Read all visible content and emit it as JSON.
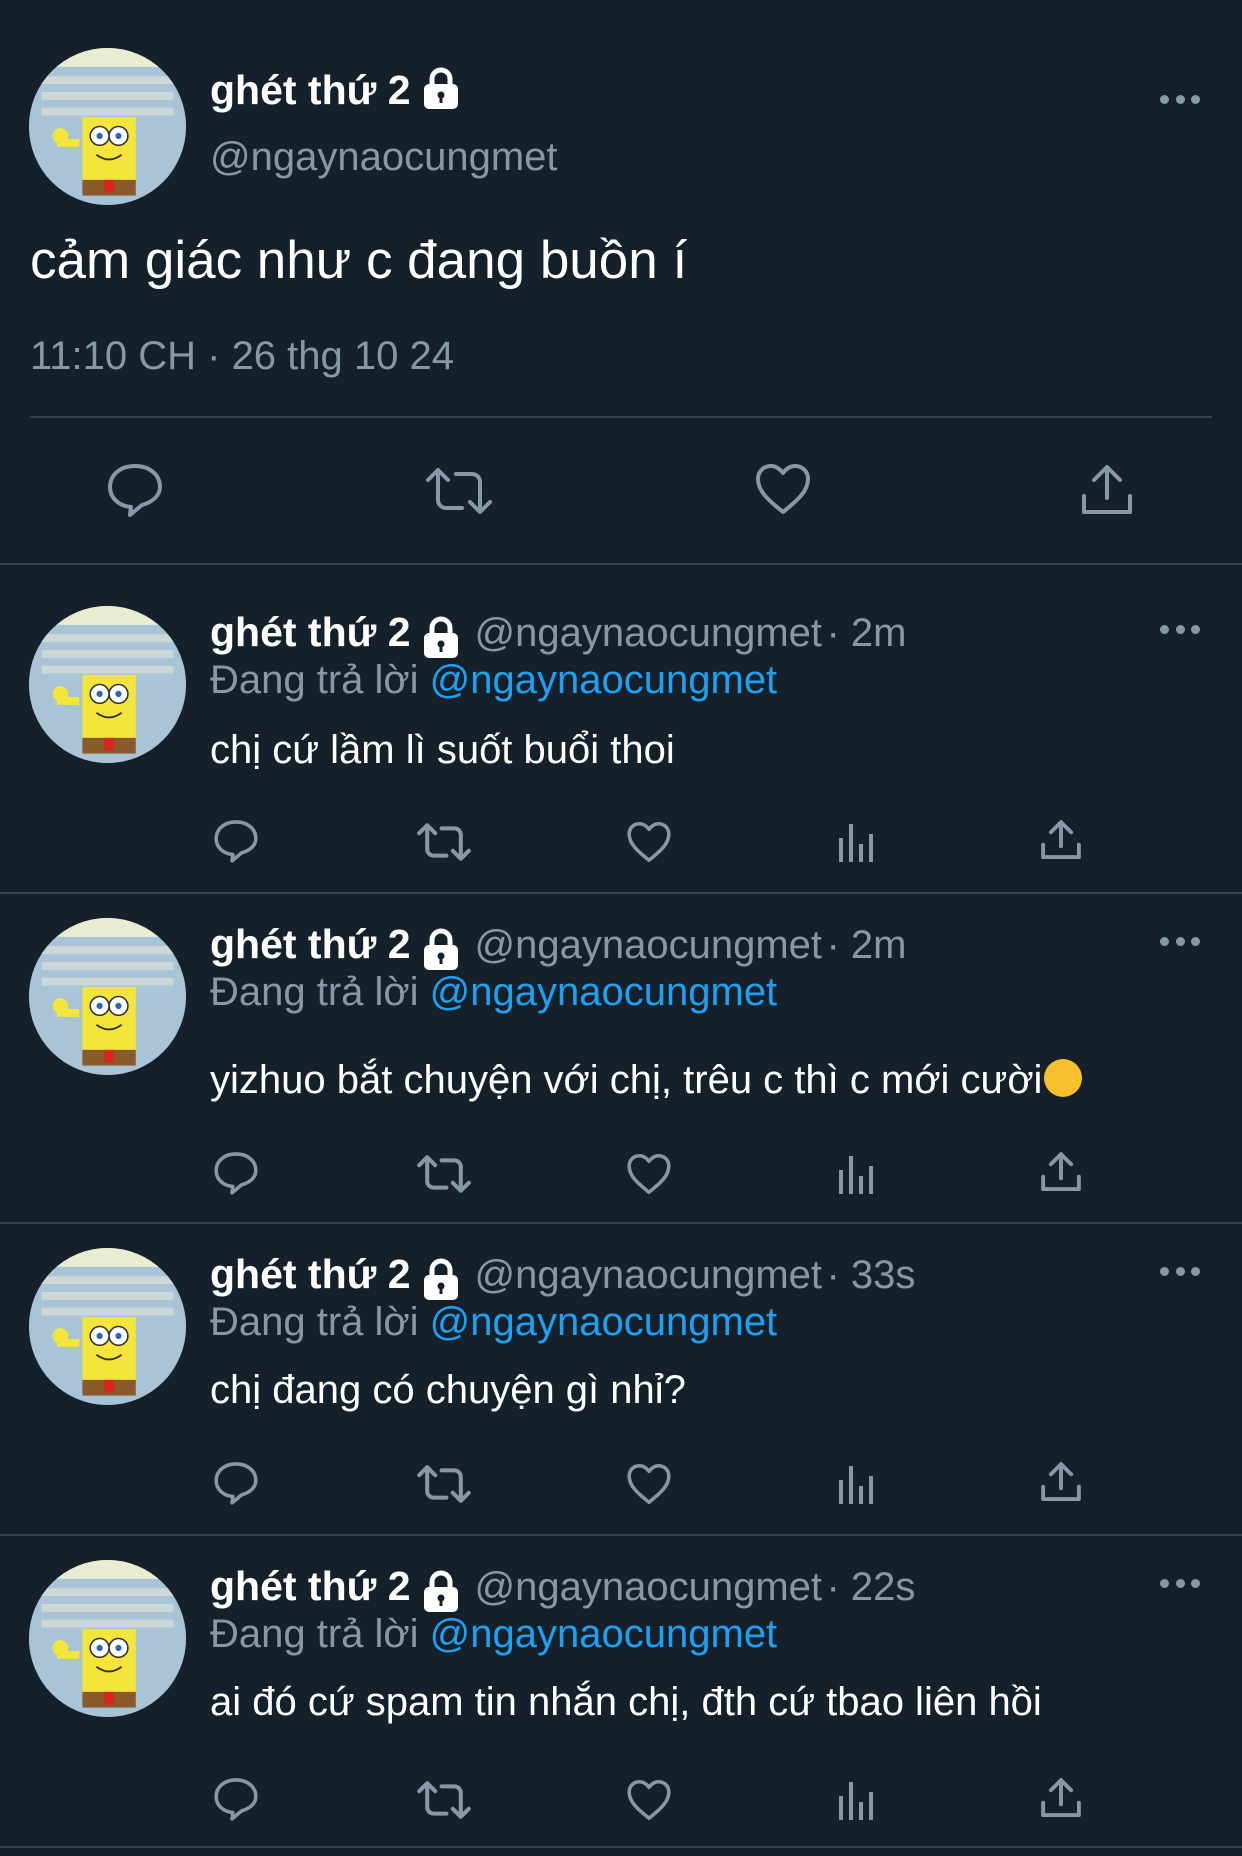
{
  "main": {
    "name": "ghét thứ 2",
    "handle": "@ngaynaocungmet",
    "text": "cảm giác như c đang buồn í",
    "timestamp": "11:10 CH · 26 thg 10 24",
    "actions": [
      "reply-icon",
      "retweet-icon",
      "like-icon",
      "share-icon"
    ]
  },
  "replies": [
    {
      "name": "ghét thứ 2",
      "handle": "@ngaynaocungmet",
      "time": "· 2m",
      "replying_prefix": "Đang trả lời",
      "replying_to": "@ngaynaocungmet",
      "text": "chị cứ lầm lì suốt buổi thoi"
    },
    {
      "name": "ghét thứ 2",
      "handle": "@ngaynaocungmet",
      "time": "· 2m",
      "replying_prefix": "Đang trả lời",
      "replying_to": "@ngaynaocungmet",
      "text": "yizhuo bắt chuyện với chị, trêu c thì c mới cười"
    },
    {
      "name": "ghét thứ 2",
      "handle": "@ngaynaocungmet",
      "time": "· 33s",
      "replying_prefix": "Đang trả lời",
      "replying_to": "@ngaynaocungmet",
      "text": "chị đang có chuyện gì nhỉ?"
    },
    {
      "name": "ghét thứ 2",
      "handle": "@ngaynaocungmet",
      "time": "· 22s",
      "replying_prefix": "Đang trả lời",
      "replying_to": "@ngaynaocungmet",
      "text": "ai đó cứ spam tin nhắn chị, đth cứ tbao liên hồi"
    }
  ],
  "colors": {
    "background": "#15202b",
    "secondary_text": "#8899a6",
    "link": "#1da1f2",
    "divider": "#38444d"
  }
}
